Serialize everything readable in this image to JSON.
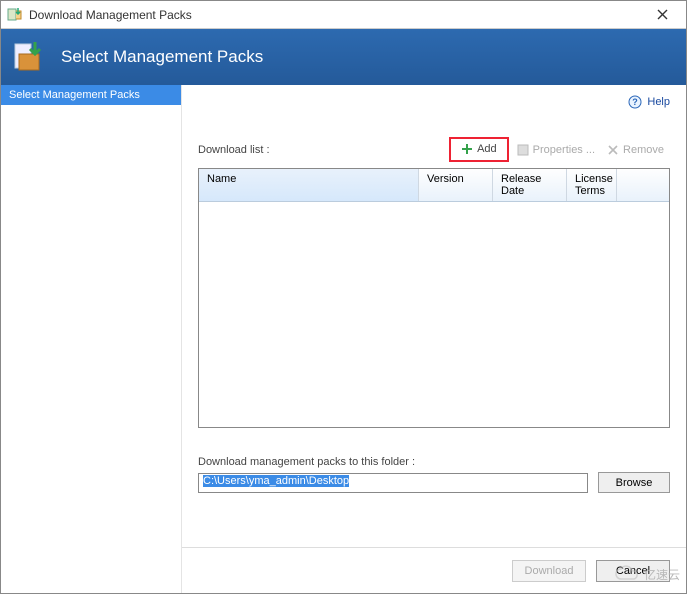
{
  "window": {
    "title": "Download Management Packs"
  },
  "banner": {
    "title": "Select Management Packs"
  },
  "sidebar": {
    "items": [
      "Select Management Packs"
    ]
  },
  "help": {
    "label": "Help"
  },
  "downloadList": {
    "label": "Download list :",
    "toolbar": {
      "add": "Add",
      "properties": "Properties ...",
      "remove": "Remove"
    },
    "columns": {
      "name": "Name",
      "version": "Version",
      "release": "Release Date",
      "license": "License Terms"
    }
  },
  "folder": {
    "label": "Download management packs to this folder :",
    "value": "C:\\Users\\yma_admin\\Desktop",
    "browse": "Browse"
  },
  "footer": {
    "download": "Download",
    "cancel": "Cancel"
  },
  "watermark": "亿速云"
}
